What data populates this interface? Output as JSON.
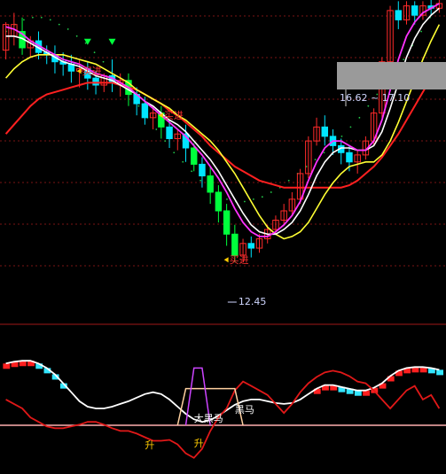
{
  "chart_data": [
    {
      "type": "candlestick",
      "panel": "price",
      "ylim": [
        11.8,
        18.0
      ],
      "range_label": "16.62 ~ 17.10",
      "low_label": "12.45",
      "annotations": [
        "买进",
        "买进",
        "买进"
      ],
      "colors": {
        "up": "#ff2a2a",
        "down": "#00e5ff",
        "strong_down": "#00ff3c",
        "ma_fast": "#ff33ff",
        "ma_mid": "#ffffff",
        "ma_slow": "#ffff33",
        "ma_long": "#ff2020",
        "dotted": "#22c84a",
        "tri": "#00ff3c"
      },
      "candles": [
        [
          17.0,
          17.6,
          17.55,
          16.8
        ],
        [
          17.3,
          17.8,
          17.55,
          17.1
        ],
        [
          17.4,
          17.7,
          17.05,
          16.9
        ],
        [
          17.05,
          17.3,
          17.2,
          16.85
        ],
        [
          17.2,
          17.4,
          16.95,
          16.8
        ],
        [
          16.95,
          17.1,
          16.9,
          16.7
        ],
        [
          16.9,
          17.1,
          16.75,
          16.5
        ],
        [
          16.75,
          16.95,
          16.7,
          16.45
        ],
        [
          16.7,
          16.9,
          16.55,
          16.3
        ],
        [
          16.55,
          16.8,
          16.6,
          16.2
        ],
        [
          16.6,
          16.75,
          16.4,
          16.15
        ],
        [
          16.4,
          16.55,
          16.25,
          16.05
        ],
        [
          16.25,
          16.5,
          16.45,
          16.1
        ],
        [
          16.45,
          16.8,
          16.3,
          16.1
        ],
        [
          16.3,
          16.5,
          16.35,
          16.0
        ],
        [
          16.35,
          16.5,
          16.05,
          15.8
        ],
        [
          16.05,
          16.2,
          15.85,
          15.6
        ],
        [
          15.85,
          16.0,
          15.55,
          15.4
        ],
        [
          15.55,
          15.8,
          15.65,
          15.3
        ],
        [
          15.65,
          15.8,
          15.35,
          15.1
        ],
        [
          15.35,
          15.5,
          15.1,
          14.9
        ],
        [
          15.1,
          15.3,
          15.2,
          14.85
        ],
        [
          15.2,
          15.4,
          14.9,
          14.6
        ],
        [
          14.9,
          15.0,
          14.55,
          14.4
        ],
        [
          14.55,
          14.7,
          14.3,
          14.05
        ],
        [
          14.3,
          14.5,
          13.95,
          13.7
        ],
        [
          13.95,
          14.1,
          13.55,
          13.3
        ],
        [
          13.55,
          13.7,
          13.05,
          12.8
        ],
        [
          13.05,
          13.25,
          12.6,
          12.45
        ],
        [
          12.6,
          12.95,
          12.85,
          12.45
        ],
        [
          12.85,
          13.0,
          12.75,
          12.55
        ],
        [
          12.75,
          13.05,
          12.95,
          12.65
        ],
        [
          12.95,
          13.25,
          13.15,
          12.85
        ],
        [
          13.15,
          13.45,
          13.35,
          13.05
        ],
        [
          13.35,
          13.7,
          13.55,
          13.25
        ],
        [
          13.55,
          13.95,
          13.8,
          13.45
        ],
        [
          13.8,
          14.45,
          14.35,
          13.7
        ],
        [
          14.35,
          15.15,
          15.05,
          14.25
        ],
        [
          15.05,
          15.55,
          15.35,
          14.95
        ],
        [
          15.35,
          15.6,
          15.15,
          14.95
        ],
        [
          15.15,
          15.3,
          14.95,
          14.75
        ],
        [
          14.95,
          15.1,
          14.8,
          14.55
        ],
        [
          14.8,
          14.95,
          14.6,
          14.4
        ],
        [
          14.6,
          14.85,
          14.75,
          14.35
        ],
        [
          14.75,
          15.15,
          15.05,
          14.65
        ],
        [
          15.05,
          15.75,
          15.65,
          14.95
        ],
        [
          15.65,
          16.85,
          16.75,
          15.55
        ],
        [
          16.75,
          17.95,
          17.85,
          16.65
        ],
        [
          17.85,
          18.05,
          17.65,
          17.45
        ],
        [
          17.65,
          18.05,
          17.95,
          17.55
        ],
        [
          17.95,
          18.05,
          17.75,
          17.55
        ],
        [
          17.75,
          18.05,
          17.95,
          17.65
        ],
        [
          17.95,
          18.1,
          17.9,
          17.75
        ],
        [
          17.9,
          18.1,
          18.0,
          17.8
        ]
      ],
      "ma_fast": [
        17.5,
        17.45,
        17.35,
        17.2,
        17.1,
        17.0,
        16.9,
        16.8,
        16.75,
        16.7,
        16.6,
        16.5,
        16.45,
        16.4,
        16.3,
        16.2,
        16.05,
        15.9,
        15.75,
        15.6,
        15.45,
        15.3,
        15.15,
        14.95,
        14.75,
        14.5,
        14.25,
        13.95,
        13.6,
        13.3,
        13.1,
        13.0,
        13.0,
        13.1,
        13.25,
        13.45,
        13.75,
        14.2,
        14.6,
        14.9,
        15.05,
        15.05,
        14.95,
        14.85,
        14.85,
        15.05,
        15.5,
        16.15,
        16.8,
        17.3,
        17.6,
        17.8,
        17.9,
        18.0
      ],
      "ma_mid": [
        17.3,
        17.3,
        17.25,
        17.15,
        17.05,
        16.95,
        16.85,
        16.75,
        16.7,
        16.65,
        16.55,
        16.45,
        16.4,
        16.35,
        16.25,
        16.15,
        16.05,
        15.9,
        15.8,
        15.65,
        15.5,
        15.4,
        15.25,
        15.05,
        14.85,
        14.65,
        14.4,
        14.1,
        13.8,
        13.5,
        13.25,
        13.1,
        13.05,
        13.05,
        13.15,
        13.3,
        13.55,
        13.9,
        14.3,
        14.6,
        14.8,
        14.9,
        14.9,
        14.85,
        14.85,
        14.95,
        15.25,
        15.75,
        16.3,
        16.85,
        17.25,
        17.55,
        17.75,
        17.9
      ],
      "ma_slow": [
        16.4,
        16.6,
        16.75,
        16.85,
        16.9,
        16.9,
        16.9,
        16.9,
        16.85,
        16.8,
        16.75,
        16.7,
        16.6,
        16.5,
        16.4,
        16.3,
        16.15,
        16.05,
        15.95,
        15.85,
        15.75,
        15.6,
        15.5,
        15.35,
        15.2,
        15.05,
        14.85,
        14.6,
        14.35,
        14.05,
        13.75,
        13.45,
        13.2,
        13.05,
        12.95,
        13.0,
        13.1,
        13.3,
        13.6,
        13.9,
        14.15,
        14.35,
        14.5,
        14.55,
        14.6,
        14.6,
        14.75,
        15.05,
        15.45,
        15.9,
        16.35,
        16.8,
        17.2,
        17.55
      ],
      "ma_long": [
        15.2,
        15.4,
        15.6,
        15.8,
        15.95,
        16.05,
        16.1,
        16.15,
        16.2,
        16.25,
        16.3,
        16.3,
        16.3,
        16.3,
        16.25,
        16.2,
        16.15,
        16.05,
        15.95,
        15.85,
        15.7,
        15.6,
        15.45,
        15.3,
        15.15,
        14.95,
        14.8,
        14.65,
        14.5,
        14.4,
        14.3,
        14.2,
        14.15,
        14.1,
        14.05,
        14.05,
        14.05,
        14.05,
        14.05,
        14.05,
        14.05,
        14.05,
        14.1,
        14.2,
        14.35,
        14.5,
        14.7,
        14.95,
        15.2,
        15.5,
        15.8,
        16.1,
        16.4,
        16.7
      ],
      "dotted": [
        17.4,
        17.55,
        17.65,
        17.7,
        17.7,
        17.65,
        17.55,
        17.45,
        17.3,
        17.15,
        16.95,
        16.75,
        16.55,
        16.3,
        16.05,
        15.8,
        15.55,
        15.3,
        15.05,
        14.8,
        14.6,
        14.4,
        14.2,
        14.05,
        13.9,
        13.8,
        13.75,
        13.75,
        13.8,
        13.85,
        13.95,
        14.05,
        14.2,
        14.35,
        14.5,
        14.65,
        14.8,
        14.95,
        15.15,
        15.35,
        15.55,
        15.8,
        16.05,
        16.3,
        16.55,
        16.8,
        17.1,
        17.4,
        17.7,
        18.0
      ]
    },
    {
      "type": "line",
      "panel": "indicator",
      "ylim": [
        -60,
        80
      ],
      "baseline": 0,
      "series": [
        {
          "values": [
            60,
            62,
            63,
            63,
            60,
            55,
            48,
            38,
            28,
            18,
            12,
            10,
            10,
            12,
            15,
            18,
            22,
            26,
            28,
            26,
            20,
            12,
            4,
            -2,
            -5,
            -3,
            2,
            8,
            14,
            18,
            20,
            20,
            18,
            16,
            15,
            16,
            20,
            26,
            32,
            36,
            36,
            34,
            32,
            30,
            30,
            33,
            38,
            46,
            52,
            55,
            56,
            56,
            55,
            53
          ]
        },
        {
          "values": [
            20,
            15,
            10,
            0,
            -5,
            -10,
            -12,
            -12,
            -10,
            -8,
            -5,
            -5,
            -8,
            -12,
            -15,
            -15,
            -18,
            -22,
            -26,
            -26,
            -25,
            -30,
            -40,
            -45,
            -35,
            -15,
            0,
            10,
            30,
            40,
            35,
            30,
            25,
            15,
            5,
            15,
            28,
            38,
            45,
            50,
            52,
            50,
            46,
            40,
            38,
            30,
            20,
            10,
            20,
            30,
            35,
            20,
            25,
            10
          ]
        }
      ],
      "bar_values": [
        60,
        62,
        63,
        63,
        60,
        55,
        48,
        38,
        28,
        18,
        12,
        10,
        10,
        12,
        15,
        18,
        22,
        26,
        28,
        26,
        20,
        12,
        4,
        -2,
        -5,
        -3,
        2,
        8,
        14,
        18,
        20,
        20,
        18,
        16,
        15,
        16,
        20,
        26,
        32,
        36,
        36,
        34,
        32,
        30,
        30,
        33,
        38,
        46,
        52,
        55,
        56,
        56,
        55,
        53
      ],
      "signal_labels": [
        "大黑马",
        "黑马",
        "升",
        "升"
      ]
    }
  ]
}
